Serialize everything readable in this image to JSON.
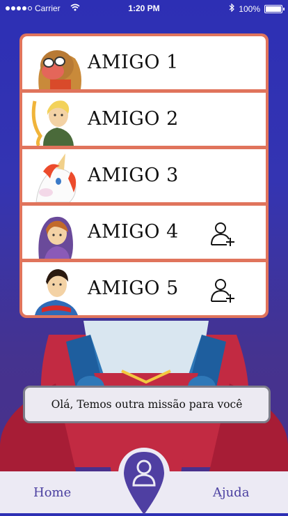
{
  "status_bar": {
    "carrier": "Carrier",
    "time": "1:20 PM",
    "battery": "100%",
    "wifi_icon": "wifi-icon",
    "bluetooth_icon": "bluetooth-icon"
  },
  "friends": [
    {
      "name": "AMIGO 1",
      "avatar": "dwarf-avatar",
      "can_add": false
    },
    {
      "name": "AMIGO 2",
      "avatar": "blond-hero-avatar",
      "can_add": false
    },
    {
      "name": "AMIGO 3",
      "avatar": "unicorn-avatar",
      "can_add": false
    },
    {
      "name": "AMIGO 4",
      "avatar": "hooded-girl-avatar",
      "can_add": true
    },
    {
      "name": "AMIGO 5",
      "avatar": "boy-avatar",
      "can_add": true
    }
  ],
  "message": "Olá, Temos outra missão para você",
  "nav": {
    "home_label": "Home",
    "help_label": "Ajuda",
    "profile_icon": "user-pin-icon"
  },
  "colors": {
    "background": "#2d2fb4",
    "panel_border": "#e0745c",
    "nav_accent": "#4a3fa0"
  }
}
